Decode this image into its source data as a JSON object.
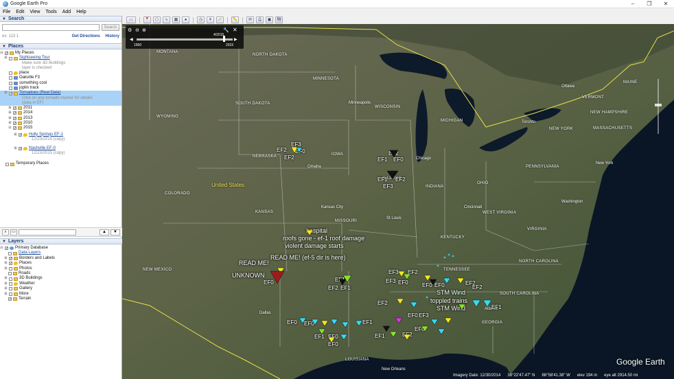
{
  "window": {
    "title": "Google Earth Pro",
    "controls": [
      "–",
      "❐",
      "✕"
    ]
  },
  "menu": [
    "File",
    "Edit",
    "View",
    "Tools",
    "Add",
    "Help"
  ],
  "search": {
    "header": "Search",
    "button": "Search",
    "hint": "ex: 113 1",
    "get_directions": "Get Directions",
    "history": "History"
  },
  "places": {
    "header": "Places",
    "items": [
      {
        "label": "My Places",
        "sub": null
      },
      {
        "label": "Sightseeing Tour",
        "sub": "Make sure 3D Buildings",
        "sub2": "layer is checked"
      },
      {
        "label": "place"
      },
      {
        "label": "Oakville F3"
      },
      {
        "label": "something cool"
      },
      {
        "label": "joplin track"
      },
      {
        "label": "Tornadoes (Real Data)",
        "sub": "Click on any tornado marker for details",
        "sub2": "(data in EF)"
      },
      {
        "label": "2011"
      },
      {
        "label": "2014"
      },
      {
        "label": "2013"
      },
      {
        "label": "2010"
      },
      {
        "label": "2015"
      },
      {
        "label": "Holly Springs EF-1",
        "sub": "12/23/2015 (copy)"
      },
      {
        "label": "Nashville EF-0",
        "sub": "12/23/2015 (copy)"
      },
      {
        "label": "Temporary Places"
      }
    ]
  },
  "layers": {
    "header": "Layers",
    "items": [
      {
        "label": "Primary Database"
      },
      {
        "label": "Data Layers"
      },
      {
        "label": "Borders and Labels"
      },
      {
        "label": "Places"
      },
      {
        "label": "Photos"
      },
      {
        "label": "Roads"
      },
      {
        "label": "3D Buildings"
      },
      {
        "label": "Weather"
      },
      {
        "label": "Gallery"
      },
      {
        "label": "More"
      },
      {
        "label": "Terrain"
      }
    ]
  },
  "timeslider": {
    "date": "4/2015",
    "start": "1950",
    "end": "2015"
  },
  "map": {
    "country": "United States",
    "states": [
      "MONTANA",
      "NORTH DAKOTA",
      "MINNESOTA",
      "SOUTH DAKOTA",
      "WYOMING",
      "WISCONSIN",
      "MICHIGAN",
      "NEBRASKA",
      "IOWA",
      "ILLINOIS",
      "INDIANA",
      "OHIO",
      "PENNSYLVANIA",
      "NEW YORK",
      "VERMONT",
      "NEW HAMPSHIRE",
      "MASSACHUSETTS",
      "MAINE",
      "COLORADO",
      "KANSAS",
      "MISSOURI",
      "KENTUCKY",
      "WEST VIRGINIA",
      "VIRGINIA",
      "NORTH CAROLINA",
      "SOUTH CAROLINA",
      "TENNESSEE",
      "GEORGIA",
      "NEW MEXICO",
      "LOUISIANA"
    ],
    "cities": [
      "Minneapolis",
      "Chicago",
      "Omaha",
      "Kansas City",
      "St Louis",
      "Cincinnati",
      "Toronto",
      "Ottawa",
      "New York",
      "Washington",
      "Atlanta",
      "Dallas",
      "New Orleans"
    ],
    "annotations": [
      "hospital",
      "roofs gone - ef-1 roof damage",
      "violent damage starts",
      "READ ME!",
      "READ ME! (ef-5 dir is here)",
      "UNKNOWN",
      "STM Wind",
      "toppled trains",
      "STM Wind"
    ],
    "ef_labels": [
      "EF0",
      "EF1",
      "EF2",
      "EF3",
      "EF4"
    ]
  },
  "status": {
    "imagery_date": "Imagery Date: 12/30/2014",
    "lat": "38°22'47.47\" N",
    "lon": "88°58'41.38\" W",
    "elev": "elev  194 m",
    "eye_alt": "eye alt 2914.50 mi"
  },
  "brand": "Google Earth"
}
